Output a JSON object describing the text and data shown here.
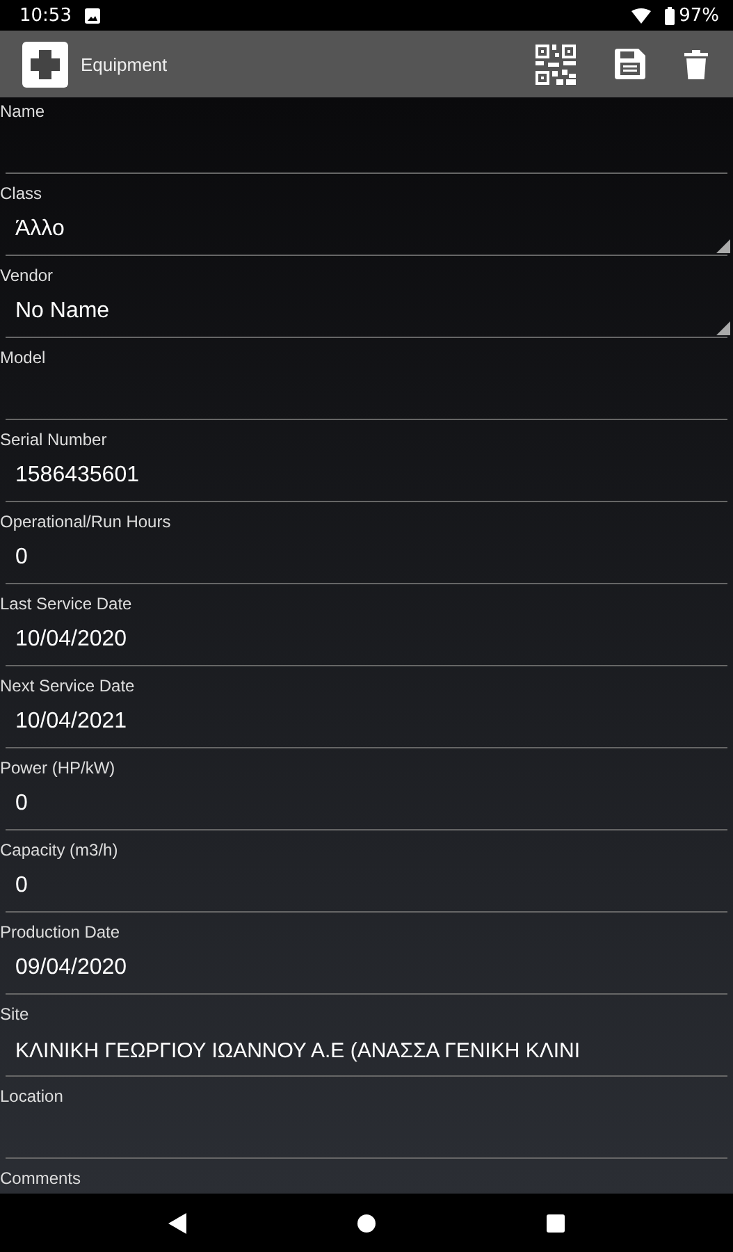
{
  "status_bar": {
    "time": "10:53",
    "battery": "97%"
  },
  "toolbar": {
    "title": "Equipment"
  },
  "fields": [
    {
      "label": "Name",
      "kind": "text"
    },
    {
      "label": "Class",
      "kind": "dropdown",
      "value": "Άλλο"
    },
    {
      "label": "Vendor",
      "kind": "dropdown",
      "value": "No Name"
    },
    {
      "label": "Model",
      "kind": "text"
    },
    {
      "label": "Serial Number",
      "kind": "text",
      "value": "1586435601"
    },
    {
      "label": "Operational/Run Hours",
      "kind": "text",
      "value": "0"
    },
    {
      "label": "Last Service Date",
      "kind": "text",
      "value": "10/04/2020"
    },
    {
      "label": "Next Service Date",
      "kind": "text",
      "value": "10/04/2021"
    },
    {
      "label": "Power (HP/kW)",
      "kind": "text",
      "value": "0"
    },
    {
      "label": "Capacity (m3/h)",
      "kind": "text",
      "value": "0"
    },
    {
      "label": "Production Date",
      "kind": "text",
      "value": "09/04/2020"
    },
    {
      "label": "Site",
      "kind": "text",
      "value": "ΚΛΙΝΙΚΗ ΓΕΩΡΓΙΟΥ ΙΩΑΝΝΟΥ Α.Ε (ΑΝΑΣΣΑ ΓΕΝΙΚΗ ΚΛΙΝΙ"
    },
    {
      "label": "Location",
      "kind": "text"
    },
    {
      "label": "Comments",
      "kind": "label_only"
    }
  ]
}
